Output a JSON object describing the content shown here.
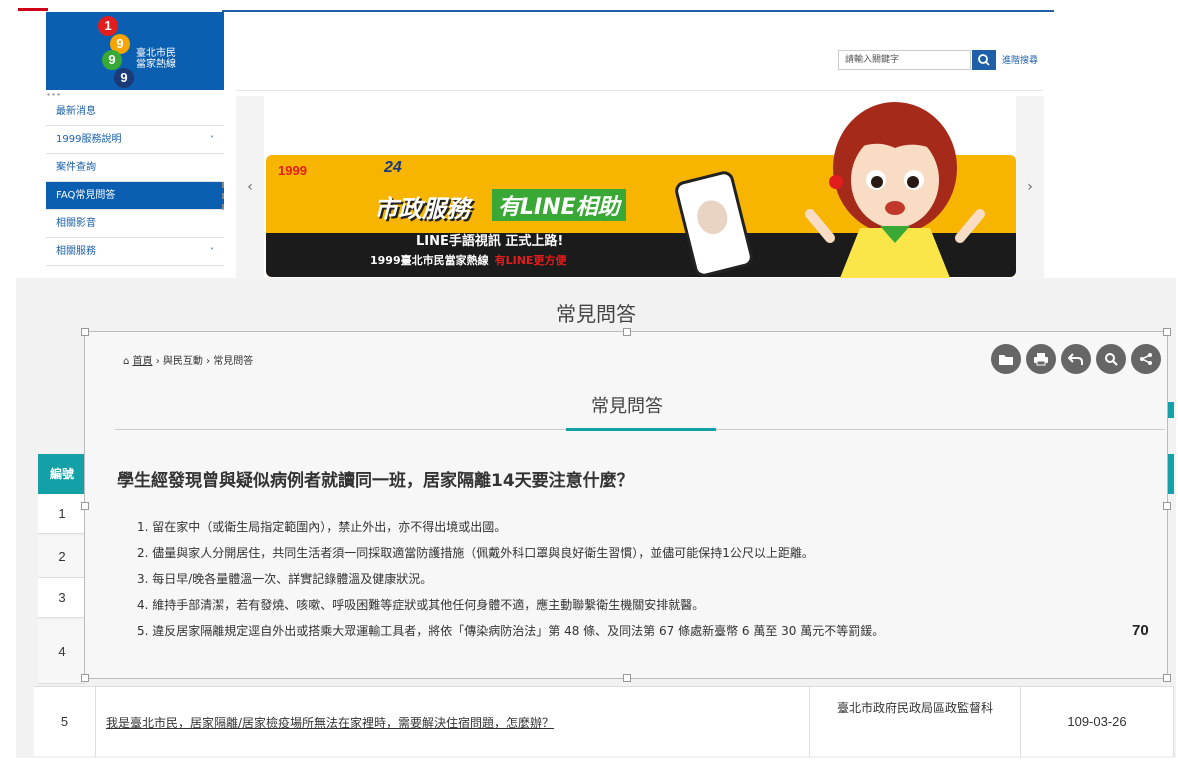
{
  "logo": {
    "digits": [
      "1",
      "9",
      "9",
      "9"
    ],
    "line1": "臺北市民",
    "line2": "當家熱線",
    "colors": {
      "bg": "#0b5fb0",
      "red": "#e21d1d",
      "orange": "#f7a600",
      "green": "#39a935",
      "navy": "#1a3a78"
    }
  },
  "sidebar": {
    "items": [
      {
        "label": "最新消息",
        "has_arrow": false
      },
      {
        "label": "1999服務說明",
        "has_arrow": true
      },
      {
        "label": "案件查詢",
        "has_arrow": false
      },
      {
        "label": "FAQ常見問答",
        "has_arrow": false,
        "active": true
      },
      {
        "label": "相關影音",
        "has_arrow": false
      },
      {
        "label": "相關服務",
        "has_arrow": true
      }
    ],
    "arrow": "˅"
  },
  "search": {
    "placeholder": "請輸入關鍵字",
    "button_icon": "search-icon",
    "advanced_label": "進階搜尋"
  },
  "banner": {
    "prev": "‹",
    "next": "›",
    "logo_digits": "1999",
    "anniversary": "24",
    "headline_a": "市政服務",
    "headline_b": "有LINE相助",
    "line2": "LINE手語視訊  正式上路!",
    "line3": "1999臺北市民當家熱線",
    "line3_tag": "有LINE更方便"
  },
  "lower": {
    "title": "常見問答",
    "table_header": "編號",
    "row_numbers": [
      "1",
      "2",
      "3",
      "4"
    ]
  },
  "popup": {
    "breadcrumb": {
      "home": "首頁",
      "sep": "›",
      "level2": "與民互動",
      "level3": "常見問答"
    },
    "tools": [
      "folder-icon",
      "print-icon",
      "back-icon",
      "search-icon",
      "share-icon"
    ],
    "title": "常見問答",
    "question": "學生經發現曾與疑似病例者就讀同一班，居家隔離14天要注意什麼？",
    "answers": [
      "1. 留在家中（或衛生局指定範圍內），禁止外出，亦不得出境或出國。",
      "2. 儘量與家人分開居住，共同生活者須一同採取適當防護措施（佩戴外科口罩與良好衛生習慣），並儘可能保持1公尺以上距離。",
      "3. 每日早/晚各量體溫一次、詳實記錄體溫及健康狀況。",
      "4. 維持手部清潔，若有發燒、咳嗽、呼吸困難等症狀或其他任何身體不適，應主動聯繫衛生機關安排就醫。",
      "5. 違反居家隔離規定逕自外出或搭乘大眾運輸工具者，將依「傳染病防治法」第 48 條、及同法第 67 條處新臺幣 6 萬至 30 萬元不等罰鍰。"
    ],
    "page_marker": "70"
  },
  "row5": {
    "num": "5",
    "question": "我是臺北市民，居家隔離/居家檢疫場所無法在家裡時，需要解決住宿問題，怎麼辦？",
    "dept": "臺北市政府民政局區政監督科",
    "date": "109-03-26"
  },
  "accent": "#13a0a6"
}
